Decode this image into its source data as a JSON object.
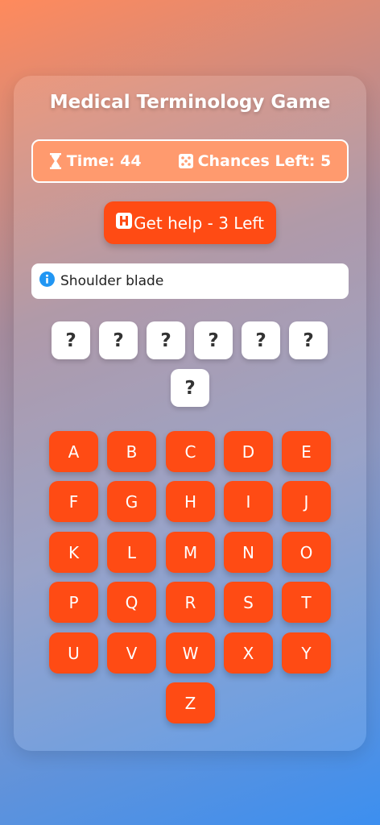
{
  "game": {
    "title": "Medical Terminology Game",
    "time_label": "Time: 44",
    "chances_label": "Chances Left: 5",
    "help_label": "Get help - 3 Left",
    "hint_text": "Shoulder blade",
    "word_slots": [
      "?",
      "?",
      "?",
      "?",
      "?",
      "?",
      "?"
    ],
    "keys": [
      "A",
      "B",
      "C",
      "D",
      "E",
      "F",
      "G",
      "H",
      "I",
      "J",
      "K",
      "L",
      "M",
      "N",
      "O",
      "P",
      "Q",
      "R",
      "S",
      "T",
      "U",
      "V",
      "W",
      "X",
      "Y",
      "Z"
    ]
  },
  "icons": {
    "timer": "hourglass-icon",
    "chances": "dice-icon",
    "help": "hospital-h-icon",
    "hint": "info-icon"
  },
  "colors": {
    "accent": "#ff4b14",
    "status_bar": "#ff9a6e",
    "info": "#2196f3"
  }
}
